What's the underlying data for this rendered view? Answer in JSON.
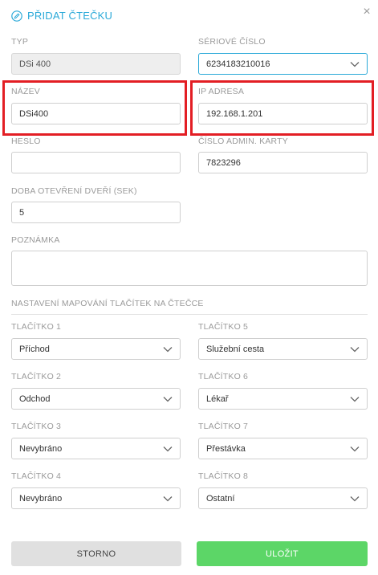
{
  "dialog": {
    "title": "PŘIDAT ČTEČKU",
    "close_symbol": "×",
    "title_icon": "pencil-circle-icon"
  },
  "fields": {
    "typ": {
      "label": "TYP",
      "value": "DSi 400"
    },
    "serial": {
      "label": "SÉRIOVÉ ČÍSLO",
      "value": "6234183210016"
    },
    "nazev": {
      "label": "NÁZEV",
      "value": "DSi400"
    },
    "ip": {
      "label": "IP ADRESA",
      "value": "192.168.1.201"
    },
    "heslo": {
      "label": "HESLO",
      "value": ""
    },
    "admin_card": {
      "label": "ČÍSLO ADMIN. KARTY",
      "value": "7823296"
    },
    "door_time": {
      "label": "DOBA OTEVŘENÍ DVEŘÍ (SEK)",
      "value": "5"
    },
    "note": {
      "label": "POZNÁMKA",
      "value": ""
    }
  },
  "mapping": {
    "section_title": "NASTAVENÍ MAPOVÁNÍ TLAČÍTEK NA ČTEČCE",
    "buttons": [
      {
        "label": "TLAČÍTKO 1",
        "value": "Příchod"
      },
      {
        "label": "TLAČÍTKO 2",
        "value": "Odchod"
      },
      {
        "label": "TLAČÍTKO 3",
        "value": "Nevybráno"
      },
      {
        "label": "TLAČÍTKO 4",
        "value": "Nevybráno"
      },
      {
        "label": "TLAČÍTKO 5",
        "value": "Služební cesta"
      },
      {
        "label": "TLAČÍTKO 6",
        "value": "Lékař"
      },
      {
        "label": "TLAČÍTKO 7",
        "value": "Přestávka"
      },
      {
        "label": "TLAČÍTKO 8",
        "value": "Ostatní"
      }
    ]
  },
  "actions": {
    "cancel_label": "STORNO",
    "save_label": "ULOŽIT"
  },
  "colors": {
    "accent": "#2aa9d8",
    "highlight": "#e31e24",
    "save": "#5cd667"
  }
}
